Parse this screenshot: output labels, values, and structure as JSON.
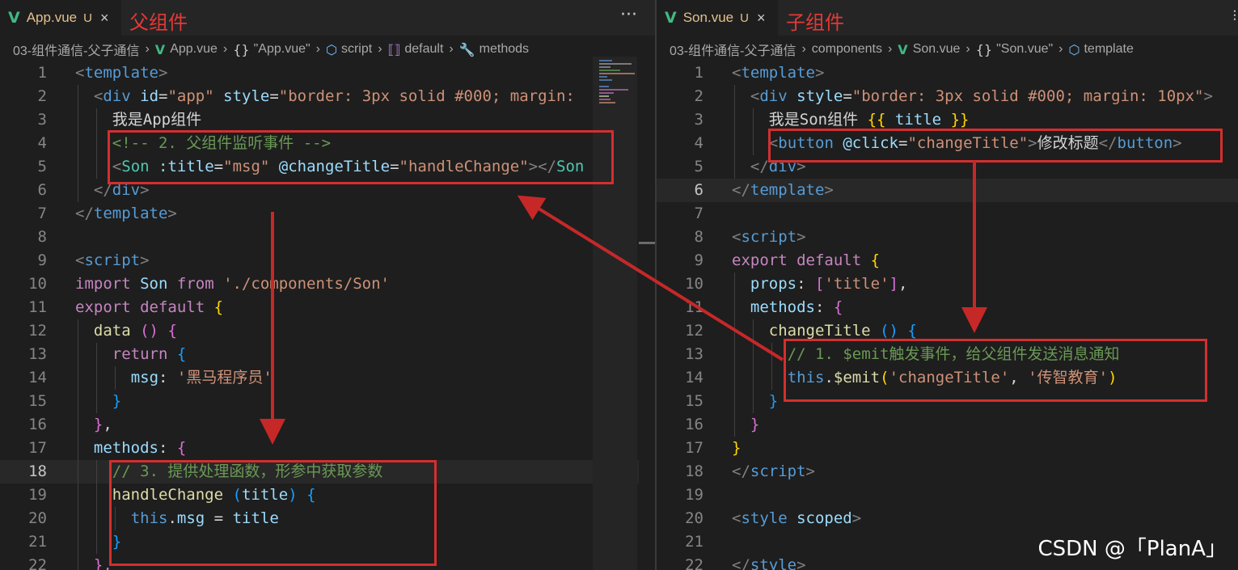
{
  "left": {
    "tab": {
      "icon": "vue-logo-icon",
      "name": "App.vue",
      "status": "U",
      "close": "×"
    },
    "annotation": "父组件",
    "more": "···",
    "breadcrumb": [
      "03-组件通信-父子通信",
      "App.vue",
      "\"App.vue\"",
      "script",
      "default",
      "methods"
    ],
    "lines": [
      {
        "n": "1",
        "tokens": [
          [
            "t-br",
            "<"
          ],
          [
            "t-tag",
            "template"
          ],
          [
            "t-br",
            ">"
          ]
        ]
      },
      {
        "n": "2",
        "tokens": [
          [
            "t-br",
            "<"
          ],
          [
            "t-tag",
            "div"
          ],
          [
            "t-plain",
            " "
          ],
          [
            "t-attr",
            "id"
          ],
          [
            "t-plain",
            "="
          ],
          [
            "t-str",
            "\"app\""
          ],
          [
            "t-plain",
            " "
          ],
          [
            "t-attr",
            "style"
          ],
          [
            "t-plain",
            "="
          ],
          [
            "t-str",
            "\"border: 3px solid #000; margin:"
          ]
        ]
      },
      {
        "n": "3",
        "tokens": [
          [
            "t-plain",
            "我是App组件"
          ]
        ]
      },
      {
        "n": "4",
        "tokens": [
          [
            "t-cm",
            "<!-- 2. 父组件监听事件 -->"
          ]
        ]
      },
      {
        "n": "5",
        "tokens": [
          [
            "t-br",
            "<"
          ],
          [
            "t-cls",
            "Son"
          ],
          [
            "t-plain",
            " "
          ],
          [
            "t-attr",
            ":title"
          ],
          [
            "t-plain",
            "="
          ],
          [
            "t-str",
            "\"msg\""
          ],
          [
            "t-plain",
            " "
          ],
          [
            "t-attr",
            "@changeTitle"
          ],
          [
            "t-plain",
            "="
          ],
          [
            "t-str",
            "\"handleChange\""
          ],
          [
            "t-br",
            ">"
          ],
          [
            "t-br",
            "</"
          ],
          [
            "t-cls",
            "Son"
          ]
        ]
      },
      {
        "n": "6",
        "tokens": [
          [
            "t-br",
            "</"
          ],
          [
            "t-tag",
            "div"
          ],
          [
            "t-br",
            ">"
          ]
        ]
      },
      {
        "n": "7",
        "tokens": [
          [
            "t-br",
            "</"
          ],
          [
            "t-tag",
            "template"
          ],
          [
            "t-br",
            ">"
          ]
        ]
      },
      {
        "n": "8",
        "tokens": []
      },
      {
        "n": "9",
        "tokens": [
          [
            "t-br",
            "<"
          ],
          [
            "t-tag",
            "script"
          ],
          [
            "t-br",
            ">"
          ]
        ]
      },
      {
        "n": "10",
        "tokens": [
          [
            "t-kw",
            "import"
          ],
          [
            "t-plain",
            " "
          ],
          [
            "t-var",
            "Son"
          ],
          [
            "t-plain",
            " "
          ],
          [
            "t-kw",
            "from"
          ],
          [
            "t-plain",
            " "
          ],
          [
            "t-str",
            "'./components/Son'"
          ]
        ]
      },
      {
        "n": "11",
        "tokens": [
          [
            "t-kw",
            "export"
          ],
          [
            "t-plain",
            " "
          ],
          [
            "t-kw",
            "default"
          ],
          [
            "t-plain",
            " "
          ],
          [
            "t-b1",
            "{"
          ]
        ]
      },
      {
        "n": "12",
        "tokens": [
          [
            "t-fn",
            "data"
          ],
          [
            "t-plain",
            " "
          ],
          [
            "t-b2",
            "()"
          ],
          [
            "t-plain",
            " "
          ],
          [
            "t-b2",
            "{"
          ]
        ]
      },
      {
        "n": "13",
        "tokens": [
          [
            "t-kw",
            "return"
          ],
          [
            "t-plain",
            " "
          ],
          [
            "t-b3",
            "{"
          ]
        ]
      },
      {
        "n": "14",
        "tokens": [
          [
            "t-var",
            "msg"
          ],
          [
            "t-plain",
            ": "
          ],
          [
            "t-str",
            "'黑马程序员'"
          ]
        ]
      },
      {
        "n": "15",
        "tokens": [
          [
            "t-b3",
            "}"
          ]
        ]
      },
      {
        "n": "16",
        "tokens": [
          [
            "t-b2",
            "}"
          ],
          [
            "t-plain",
            ","
          ]
        ]
      },
      {
        "n": "17",
        "tokens": [
          [
            "t-var",
            "methods"
          ],
          [
            "t-plain",
            ": "
          ],
          [
            "t-b2",
            "{"
          ]
        ]
      },
      {
        "n": "18",
        "tokens": [
          [
            "t-cm",
            "// 3. 提供处理函数，形参中获取参数"
          ]
        ]
      },
      {
        "n": "19",
        "tokens": [
          [
            "t-fn",
            "handleChange"
          ],
          [
            "t-plain",
            " "
          ],
          [
            "t-b3",
            "("
          ],
          [
            "t-var",
            "title"
          ],
          [
            "t-b3",
            ")"
          ],
          [
            "t-plain",
            " "
          ],
          [
            "t-b3",
            "{"
          ]
        ]
      },
      {
        "n": "20",
        "tokens": [
          [
            "t-kw2",
            "this"
          ],
          [
            "t-plain",
            "."
          ],
          [
            "t-var",
            "msg"
          ],
          [
            "t-plain",
            " = "
          ],
          [
            "t-var",
            "title"
          ]
        ]
      },
      {
        "n": "21",
        "tokens": [
          [
            "t-b3",
            "}"
          ]
        ]
      },
      {
        "n": "22",
        "tokens": [
          [
            "t-b2",
            "},"
          ]
        ]
      }
    ]
  },
  "right": {
    "tab": {
      "icon": "vue-logo-icon",
      "name": "Son.vue",
      "status": "U",
      "close": "×"
    },
    "annotation": "子组件",
    "breadcrumb": [
      "03-组件通信-父子通信",
      "components",
      "Son.vue",
      "\"Son.vue\"",
      "template"
    ],
    "lines": [
      {
        "n": "1",
        "tokens": [
          [
            "t-br",
            "<"
          ],
          [
            "t-tag",
            "template"
          ],
          [
            "t-br",
            ">"
          ]
        ]
      },
      {
        "n": "2",
        "tokens": [
          [
            "t-br",
            "<"
          ],
          [
            "t-tag",
            "div"
          ],
          [
            "t-plain",
            " "
          ],
          [
            "t-attr",
            "style"
          ],
          [
            "t-plain",
            "="
          ],
          [
            "t-str",
            "\"border: 3px solid #000; margin: 10px\""
          ],
          [
            "t-br",
            ">"
          ]
        ]
      },
      {
        "n": "3",
        "tokens": [
          [
            "t-plain",
            "我是Son组件 "
          ],
          [
            "t-b1",
            "{{"
          ],
          [
            "t-plain",
            " "
          ],
          [
            "t-var",
            "title"
          ],
          [
            "t-plain",
            " "
          ],
          [
            "t-b1",
            "}}"
          ]
        ]
      },
      {
        "n": "4",
        "tokens": [
          [
            "t-br",
            "<"
          ],
          [
            "t-tag",
            "button"
          ],
          [
            "t-plain",
            " "
          ],
          [
            "t-attr",
            "@click"
          ],
          [
            "t-plain",
            "="
          ],
          [
            "t-str",
            "\"changeTitle\""
          ],
          [
            "t-br",
            ">"
          ],
          [
            "t-plain",
            "修改标题"
          ],
          [
            "t-br",
            "</"
          ],
          [
            "t-tag",
            "button"
          ],
          [
            "t-br",
            ">"
          ]
        ]
      },
      {
        "n": "5",
        "tokens": [
          [
            "t-br",
            "</"
          ],
          [
            "t-tag",
            "div"
          ],
          [
            "t-br",
            ">"
          ]
        ]
      },
      {
        "n": "6",
        "tokens": [
          [
            "t-br",
            "</"
          ],
          [
            "t-tag",
            "template"
          ],
          [
            "t-br",
            ">"
          ]
        ]
      },
      {
        "n": "7",
        "tokens": []
      },
      {
        "n": "8",
        "tokens": [
          [
            "t-br",
            "<"
          ],
          [
            "t-tag",
            "script"
          ],
          [
            "t-br",
            ">"
          ]
        ]
      },
      {
        "n": "9",
        "tokens": [
          [
            "t-kw",
            "export"
          ],
          [
            "t-plain",
            " "
          ],
          [
            "t-kw",
            "default"
          ],
          [
            "t-plain",
            " "
          ],
          [
            "t-b1",
            "{"
          ]
        ]
      },
      {
        "n": "10",
        "tokens": [
          [
            "t-var",
            "props"
          ],
          [
            "t-plain",
            ": "
          ],
          [
            "t-b2",
            "["
          ],
          [
            "t-str",
            "'title'"
          ],
          [
            "t-b2",
            "]"
          ],
          [
            "t-plain",
            ","
          ]
        ]
      },
      {
        "n": "11",
        "tokens": [
          [
            "t-var",
            "methods"
          ],
          [
            "t-plain",
            ": "
          ],
          [
            "t-b2",
            "{"
          ]
        ]
      },
      {
        "n": "12",
        "tokens": [
          [
            "t-fn",
            "changeTitle"
          ],
          [
            "t-plain",
            " "
          ],
          [
            "t-b3",
            "()"
          ],
          [
            "t-plain",
            " "
          ],
          [
            "t-b3",
            "{"
          ]
        ]
      },
      {
        "n": "13",
        "tokens": [
          [
            "t-cm",
            "// 1. $emit触发事件，给父组件发送消息通知"
          ]
        ]
      },
      {
        "n": "14",
        "tokens": [
          [
            "t-kw2",
            "this"
          ],
          [
            "t-plain",
            "."
          ],
          [
            "t-fn",
            "$emit"
          ],
          [
            "t-b1",
            "("
          ],
          [
            "t-str",
            "'changeTitle'"
          ],
          [
            "t-plain",
            ", "
          ],
          [
            "t-str",
            "'传智教育'"
          ],
          [
            "t-b1",
            ")"
          ]
        ]
      },
      {
        "n": "15",
        "tokens": [
          [
            "t-b3",
            "}"
          ]
        ]
      },
      {
        "n": "16",
        "tokens": [
          [
            "t-b2",
            "}"
          ]
        ]
      },
      {
        "n": "17",
        "tokens": [
          [
            "t-b1",
            "}"
          ]
        ]
      },
      {
        "n": "18",
        "tokens": [
          [
            "t-br",
            "</"
          ],
          [
            "t-tag",
            "script"
          ],
          [
            "t-br",
            ">"
          ]
        ]
      },
      {
        "n": "19",
        "tokens": []
      },
      {
        "n": "20",
        "tokens": [
          [
            "t-br",
            "<"
          ],
          [
            "t-tag",
            "style"
          ],
          [
            "t-plain",
            " "
          ],
          [
            "t-attr",
            "scoped"
          ],
          [
            "t-br",
            ">"
          ]
        ]
      },
      {
        "n": "21",
        "tokens": []
      },
      {
        "n": "22",
        "tokens": [
          [
            "t-br",
            "</"
          ],
          [
            "t-tag",
            "style"
          ],
          [
            "t-br",
            ">"
          ]
        ]
      }
    ]
  },
  "watermark": "CSDN @「PlanA」",
  "colors": {
    "annotation_red": "#d32f2f",
    "vue_green": "#41b883"
  }
}
